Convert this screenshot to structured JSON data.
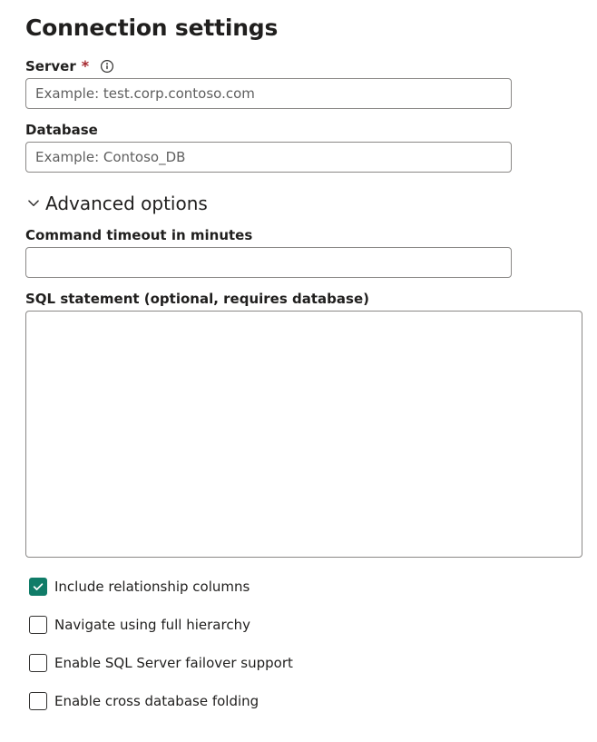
{
  "title": "Connection settings",
  "fields": {
    "server": {
      "label": "Server",
      "required_mark": "*",
      "placeholder": "Example: test.corp.contoso.com",
      "value": ""
    },
    "database": {
      "label": "Database",
      "placeholder": "Example: Contoso_DB",
      "value": ""
    }
  },
  "advanced": {
    "header": "Advanced options",
    "command_timeout": {
      "label": "Command timeout in minutes",
      "value": ""
    },
    "sql_statement": {
      "label": "SQL statement (optional, requires database)",
      "value": ""
    }
  },
  "checks": {
    "include_relationship": {
      "label": "Include relationship columns",
      "checked": true
    },
    "navigate_hierarchy": {
      "label": "Navigate using full hierarchy",
      "checked": false
    },
    "enable_failover": {
      "label": "Enable SQL Server failover support",
      "checked": false
    },
    "enable_cross_db": {
      "label": "Enable cross database folding",
      "checked": false
    }
  },
  "colors": {
    "accent": "#107c68",
    "required": "#a4262c",
    "border": "#8a8886"
  }
}
